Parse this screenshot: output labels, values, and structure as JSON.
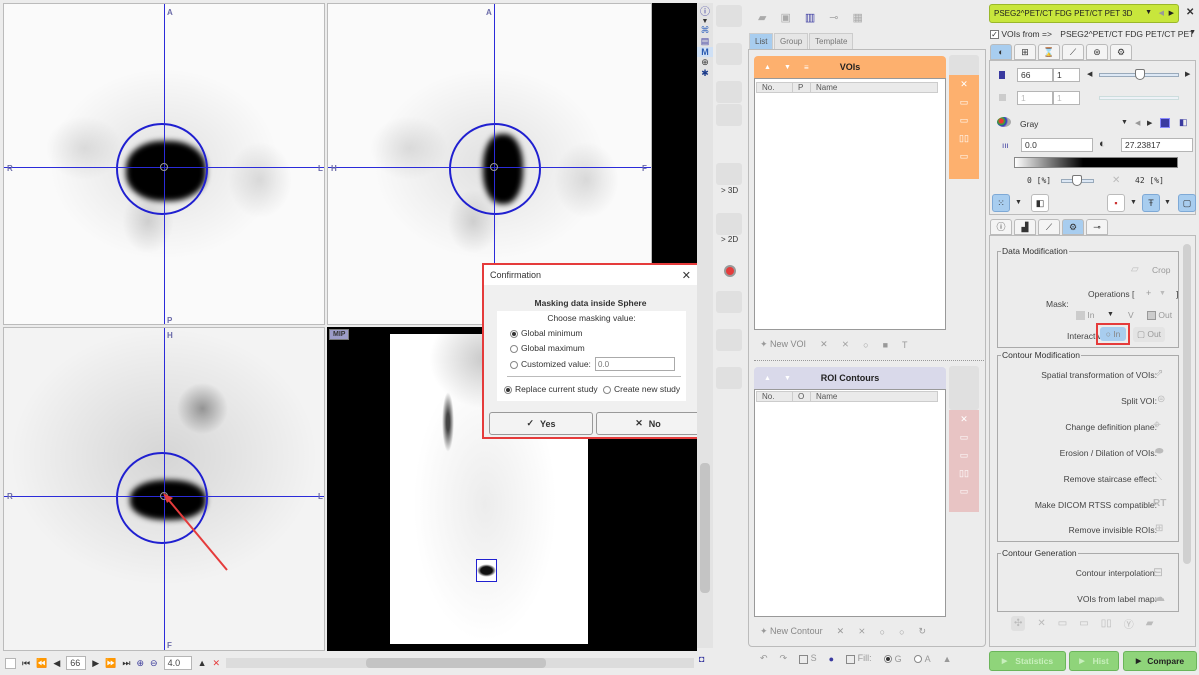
{
  "viewers": {
    "axial": {
      "orient": {
        "top": "A",
        "bottom": "P",
        "left": "R",
        "right": "L"
      }
    },
    "sagittal": {
      "orient": {
        "top": "A",
        "left": "H",
        "right": "F"
      }
    },
    "coronal": {
      "orient": {
        "top": "H",
        "bottom": "F",
        "left": "R",
        "right": "L"
      }
    },
    "mip": {
      "label": "MIP"
    }
  },
  "bottom_bar": {
    "slice": "66",
    "zoom": "4.0"
  },
  "dialog": {
    "title": "Confirmation",
    "heading": "Masking data inside Sphere",
    "subheading": "Choose masking value:",
    "options": [
      {
        "label": "Global minimum",
        "selected": true
      },
      {
        "label": "Global maximum",
        "selected": false
      },
      {
        "label": "Customized value:",
        "selected": false
      }
    ],
    "custom_value_placeholder": "0.0",
    "study_options": [
      {
        "label": "Replace current study",
        "selected": true
      },
      {
        "label": "Create new study",
        "selected": false
      }
    ],
    "yes_label": "Yes",
    "no_label": "No"
  },
  "tools": {
    "label_3d": "> 3D",
    "label_2d": "> 2D"
  },
  "voi_panel": {
    "tabs": [
      {
        "label": "List",
        "active": true
      },
      {
        "label": "Group",
        "active": false
      },
      {
        "label": "Template",
        "active": false
      }
    ],
    "voi_header": "VOIs",
    "voi_columns": [
      "No.",
      "P",
      "Name"
    ],
    "new_voi_label": "New VOI",
    "roi_header": "ROI Contours",
    "roi_columns": [
      "No.",
      "O",
      "Name"
    ],
    "new_contour_label": "New Contour",
    "bottom": {
      "s_label": "S",
      "fill_label": "Fill:",
      "g_label": "G",
      "a_label": "A"
    },
    "colors": {
      "voi": "#fdb06e",
      "roi": "#d9d9ea",
      "roi_side": "#e8c4c4"
    }
  },
  "right_panel": {
    "study_selector": "PSEG2^PET/CT FDG PET/CT PET 3D",
    "vois_from_label": "VOIs from =>",
    "vois_from_value": "PSEG2^PET/CT FDG PET/CT PET",
    "slice_value": "66",
    "slice_step": "1",
    "frame_value": "1",
    "frame_step": "1",
    "colormap": "Gray",
    "min_value": "0.0",
    "max_value": "27.23817",
    "lower_pct": "0",
    "upper_pct": "42",
    "pct_unit": "[%]",
    "slice_slider_fraction": 0.5,
    "data_modification": {
      "legend": "Data Modification",
      "crop_label": "Crop",
      "operations_label": "Operations [",
      "mask_label": "Mask:",
      "mask_in": "In",
      "mask_v": "V",
      "mask_out": "Out",
      "interactive_label": "Interactive:",
      "interactive_in": "In",
      "interactive_out": "Out"
    },
    "contour_modification": {
      "legend": "Contour Modification",
      "items": [
        "Spatial transformation of VOIs:",
        "Split VOI:",
        "Change definition plane:",
        "Erosion / Dilation of VOIs:",
        "Remove staircase effect:",
        "Make DICOM RTSS compatible:",
        "Remove invisible ROIs:"
      ]
    },
    "contour_generation": {
      "legend": "Contour Generation",
      "items": [
        "Contour interpolation:",
        "VOIs from label map:"
      ]
    },
    "buttons": {
      "statistics": "Statistics",
      "hist": "Hist",
      "compare": "Compare"
    }
  }
}
